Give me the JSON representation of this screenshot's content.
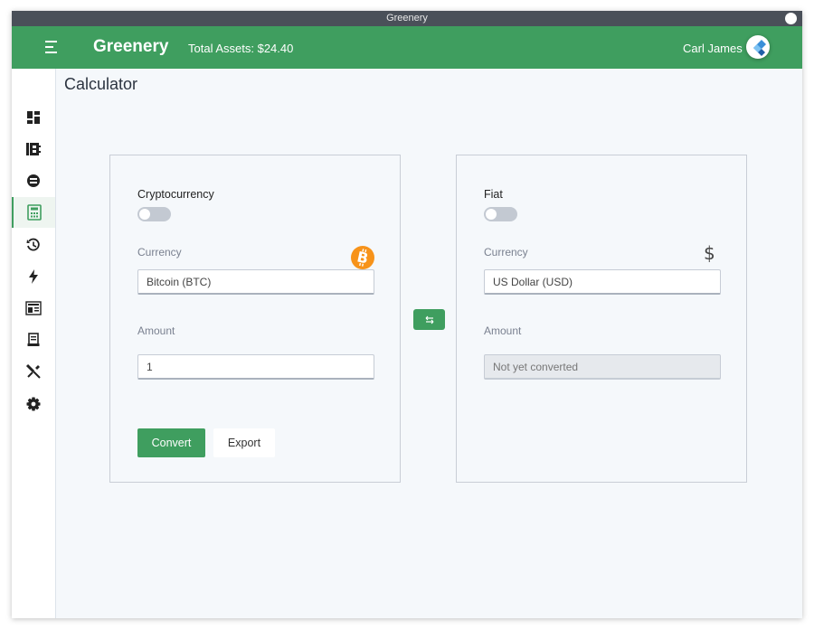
{
  "window": {
    "title": "Greenery"
  },
  "header": {
    "brand": "Greenery",
    "total_assets": "Total Assets: $24.40",
    "user_name": "Carl James"
  },
  "sidebar": {
    "items": [
      {
        "icon": "dashboard-icon"
      },
      {
        "icon": "wallet-icon"
      },
      {
        "icon": "exchange-icon"
      },
      {
        "icon": "calculator-icon",
        "active": true
      },
      {
        "icon": "history-icon"
      },
      {
        "icon": "lightning-icon"
      },
      {
        "icon": "news-icon"
      },
      {
        "icon": "receipt-icon"
      },
      {
        "icon": "tools-icon"
      },
      {
        "icon": "settings-icon"
      }
    ]
  },
  "page": {
    "title": "Calculator"
  },
  "crypto_card": {
    "title": "Cryptocurrency",
    "currency_label": "Currency",
    "currency_value": "Bitcoin (BTC)",
    "amount_label": "Amount",
    "amount_value": "1",
    "convert_label": "Convert",
    "export_label": "Export",
    "icon": "bitcoin-icon"
  },
  "fiat_card": {
    "title": "Fiat",
    "currency_label": "Currency",
    "currency_value": "US Dollar (USD)",
    "currency_symbol": "$",
    "amount_label": "Amount",
    "amount_placeholder": "Not yet converted"
  },
  "colors": {
    "accent": "#3f9e5f",
    "titlebar": "#4a5059",
    "bitcoin": "#f7931a"
  }
}
